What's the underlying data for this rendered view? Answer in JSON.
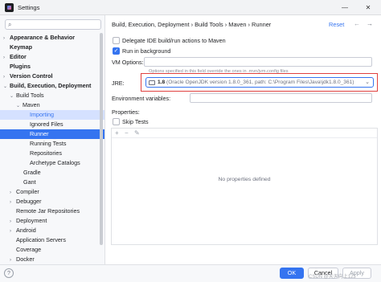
{
  "window": {
    "title": "Settings",
    "minimize": "—",
    "close": "✕"
  },
  "sidebar": {
    "items": [
      {
        "label": "Appearance & Behavior",
        "arrow": "›",
        "bold": true
      },
      {
        "label": "Keymap",
        "arrow": "",
        "bold": true
      },
      {
        "label": "Editor",
        "arrow": "›",
        "bold": true
      },
      {
        "label": "Plugins",
        "arrow": "",
        "bold": true
      },
      {
        "label": "Version Control",
        "arrow": "›",
        "bold": true
      },
      {
        "label": "Build, Execution, Deployment",
        "arrow": "⌄",
        "bold": true
      },
      {
        "label": "Build Tools",
        "arrow": "⌄"
      },
      {
        "label": "Maven",
        "arrow": "⌄"
      },
      {
        "label": "Importing"
      },
      {
        "label": "Ignored Files"
      },
      {
        "label": "Runner"
      },
      {
        "label": "Running Tests"
      },
      {
        "label": "Repositories"
      },
      {
        "label": "Archetype Catalogs"
      },
      {
        "label": "Gradle"
      },
      {
        "label": "Gant"
      },
      {
        "label": "Compiler",
        "arrow": "›"
      },
      {
        "label": "Debugger",
        "arrow": "›"
      },
      {
        "label": "Remote Jar Repositories"
      },
      {
        "label": "Deployment",
        "arrow": "›"
      },
      {
        "label": "Android",
        "arrow": "›"
      },
      {
        "label": "Application Servers"
      },
      {
        "label": "Coverage"
      },
      {
        "label": "Docker",
        "arrow": "›"
      }
    ]
  },
  "breadcrumb": "Build, Execution, Deployment  ›  Build Tools  ›  Maven  ›  Runner",
  "reset_label": "Reset",
  "nav": {
    "back": "←",
    "forward": "→"
  },
  "options": {
    "delegate_label": "Delegate IDE build/run actions to Maven",
    "background_label": "Run in background",
    "vm_options_label": "VM Options:",
    "vm_options_value": "",
    "vm_options_hint": "Options specified in this field override the ones in .mvn/jvm.config files",
    "jre_label": "JRE:",
    "jre_version": "1.8",
    "jre_detail": "(Oracle OpenJDK version 1.8.0_361, path: C:\\Program Files\\Java\\jdk1.8.0_361)",
    "env_label": "Environment variables:",
    "env_value": "",
    "properties_label": "Properties:",
    "skip_tests_label": "Skip Tests",
    "properties_empty": "No properties defined",
    "toolbar": {
      "add": "+",
      "remove": "−",
      "edit": "✎"
    }
  },
  "footer": {
    "help": "?",
    "ok": "OK",
    "cancel": "Cancel",
    "apply": "Apply"
  },
  "watermark": "CSDN @天天向上123"
}
